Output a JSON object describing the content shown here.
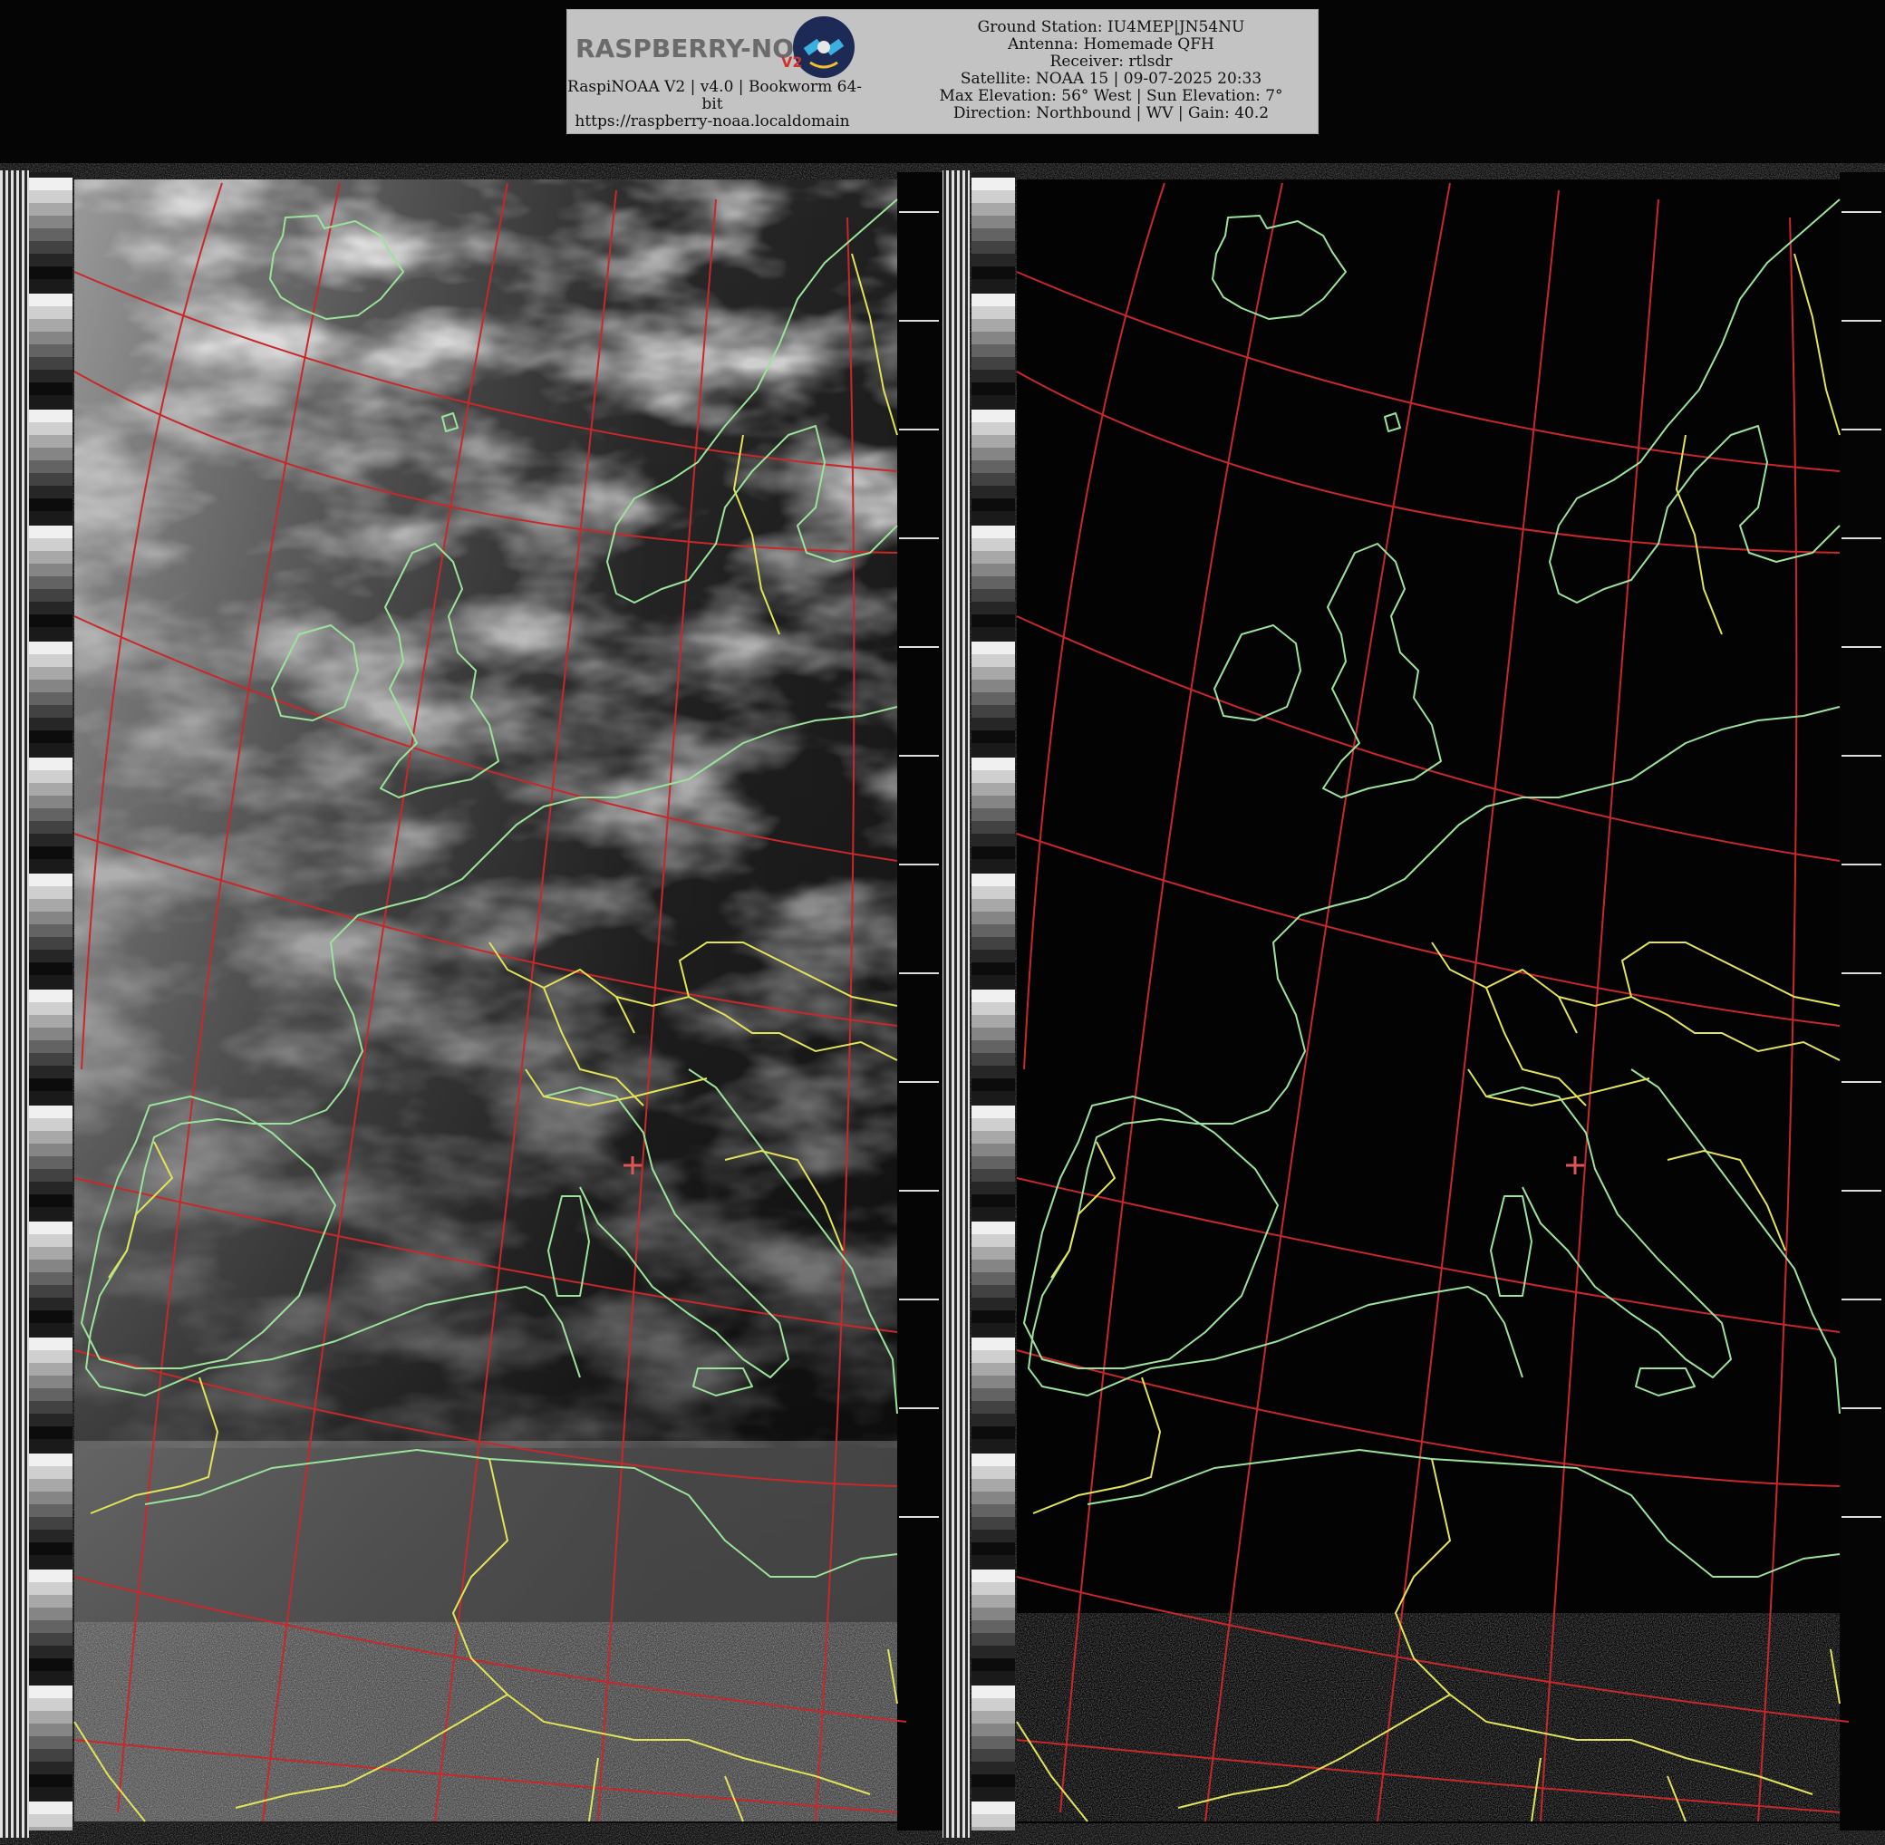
{
  "header": {
    "logo_text": "RASPBERRY-NOAA",
    "logo_badge": "V2",
    "software_line1": "RaspiNOAA V2 | v4.0 | Bookworm 64-",
    "software_line2": "bit",
    "url": "https://raspberry-noaa.localdomain",
    "ground_station": "Ground Station: IU4MEP|JN54NU",
    "antenna": "Antenna: Homemade QFH",
    "receiver": "Receiver: rtlsdr",
    "satellite": "Satellite: NOAA 15 | 09-07-2025 20:33",
    "elevation": "Max Elevation: 56° West | Sun Elevation: 7°",
    "direction": "Direction: Northbound | WV | Gain: 40.2"
  },
  "imagery": {
    "left_panel": "visible-channel",
    "right_panel": "infrared-channel",
    "graticule_color": "#c8282a",
    "coastline_color": "#9be39b",
    "border_color": "#e3e35a",
    "center_marker_color": "#e05555",
    "icon": "satellite-icon"
  }
}
